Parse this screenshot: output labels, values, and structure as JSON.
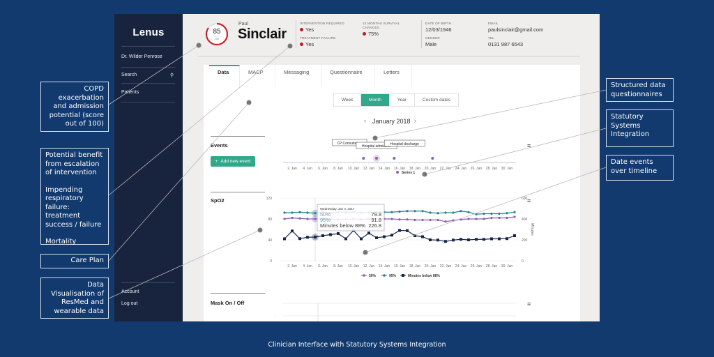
{
  "app": {
    "logo": "Lenus",
    "sidebar": {
      "user": "Dr. Wilder Penrose",
      "search_label": "Search",
      "patients_label": "Patients",
      "account_label": "Account",
      "logout_label": "Log out"
    },
    "patient": {
      "score": "85",
      "score_max": "100",
      "score_fraction": 0.85,
      "first_name": "Paul",
      "last_name": "Sinclair",
      "intervention_required_label": "Intervention required",
      "intervention_required_value": "Yes",
      "treatment_failure_label": "Treatment failure",
      "treatment_failure_value": "Yes",
      "survival_label_1": "12 months survival",
      "survival_label_2": "chances",
      "survival_value": "75%",
      "dob_label": "Date of birth",
      "dob_value": "12/03/1946",
      "gender_label": "Gender",
      "gender_value": "Male",
      "email_label": "Email",
      "email_value": "paulsinclair@gmail.com",
      "tel_label": "Tel",
      "tel_value": "0131 987 6543"
    },
    "tabs": [
      "Data",
      "MACP",
      "Messaging",
      "Questionnaire",
      "Letters"
    ],
    "active_tab": "Data",
    "range_buttons": [
      "Week",
      "Month",
      "Year",
      "Custom dates"
    ],
    "active_range": "Month",
    "month_label": "January 2018",
    "sections": {
      "events": "Events",
      "add_event": "Add new event",
      "spo2": "SpO2",
      "mask": "Mask On / Off"
    },
    "colors": {
      "accent": "#2fa88b",
      "alert": "#c0182e",
      "sidebar": "#18243d",
      "page_bg": "#123a6e"
    }
  },
  "chart_data": [
    {
      "type": "scatter",
      "title": "Events",
      "x_ticks": [
        "2. Jan",
        "4. Jan",
        "6. Jan",
        "8. Jan",
        "10. Jan",
        "12. Jan",
        "14. Jan",
        "16. Jan",
        "18. Jan",
        "20. Jan",
        "22. Jan",
        "24. Jan",
        "26. Jan",
        "28. Jan",
        "30. Jan"
      ],
      "x_range_days": [
        1,
        31
      ],
      "events": [
        {
          "day": 11.3,
          "label": "CP Consultation"
        },
        {
          "day": 13,
          "label": "Hospital admission"
        },
        {
          "day": 15.3,
          "label": "Hospital discharge"
        },
        {
          "day": 20.3,
          "label": ""
        }
      ],
      "legend": [
        "Series 1"
      ]
    },
    {
      "type": "line",
      "title": "SpO2",
      "x_ticks": [
        "2. Jan",
        "4. Jan",
        "6. Jan",
        "8. Jan",
        "10. Jan",
        "12. Jan",
        "14. Jan",
        "16. Jan",
        "18. Jan",
        "20. Jan",
        "22. Jan",
        "24. Jan",
        "26. Jan",
        "28. Jan",
        "30. Jan"
      ],
      "x_days": [
        1,
        2,
        3,
        4,
        5,
        6,
        7,
        8,
        9,
        10,
        11,
        12,
        13,
        14,
        15,
        16,
        17,
        18,
        19,
        20,
        21,
        22,
        23,
        24,
        25,
        26,
        27,
        28,
        29,
        30,
        31
      ],
      "ylim_left": [
        0,
        120
      ],
      "y_ticks_left": [
        0,
        40,
        80,
        120
      ],
      "ylim_right": [
        0,
        600
      ],
      "y_ticks_right": [
        0,
        200,
        400,
        600
      ],
      "ylabel_right": "Minutes",
      "series": [
        {
          "name": "50%",
          "axis": "left",
          "color": "#8b5fb0",
          "values": [
            80,
            82,
            81,
            80,
            80,
            80,
            79.8,
            79,
            79,
            80,
            79,
            80,
            80,
            80,
            80,
            79,
            79,
            78,
            78,
            78,
            78,
            75,
            77,
            79,
            80,
            80,
            80,
            82,
            82,
            82,
            84
          ]
        },
        {
          "name": "95%",
          "axis": "left",
          "color": "#23828c",
          "values": [
            92,
            92,
            93,
            92,
            91,
            93,
            91.8,
            93,
            93,
            93,
            92,
            92,
            93,
            93,
            93,
            94,
            95,
            95,
            95,
            92,
            91,
            92,
            92,
            95,
            93,
            89,
            90,
            90,
            90,
            91,
            93
          ]
        },
        {
          "name": "Minutes below 88%",
          "axis": "right",
          "color": "#16264a",
          "values": [
            210,
            285,
            212,
            225,
            226.8,
            240,
            250,
            260,
            210,
            290,
            210,
            265,
            220,
            230,
            245,
            290,
            288,
            240,
            230,
            200,
            198,
            185,
            198,
            205,
            200,
            205,
            205,
            210,
            210,
            212,
            240
          ]
        }
      ],
      "tooltip": {
        "date": "Wednesday, Jan 4, 2017",
        "rows": [
          {
            "label": "50%",
            "value": "79.8"
          },
          {
            "label": "95%",
            "value": "91.8"
          },
          {
            "label": "Minutes below 88%",
            "value": "226.8"
          }
        ]
      },
      "legend": [
        "50%",
        "95%",
        "Minutes below 88%"
      ],
      "legend_position": "bottom"
    }
  ],
  "annotations": {
    "copd": "COPD exacerbation and admission potential (score out of 100)",
    "benefit_1": "Potential benefit from escalation of intervention",
    "benefit_2": "Impending respiratory failure: treatment success / failure",
    "benefit_3": "Mortality",
    "care_plan": "Care Plan",
    "data_vis": "Data Visualisation of ResMed and wearable data",
    "structured": "Structured data questionnaires",
    "statutory": "Statutory Systems Integration",
    "date_events": "Date events over timeline"
  },
  "caption": "Clinician Interface with Statutory Systems Integration"
}
